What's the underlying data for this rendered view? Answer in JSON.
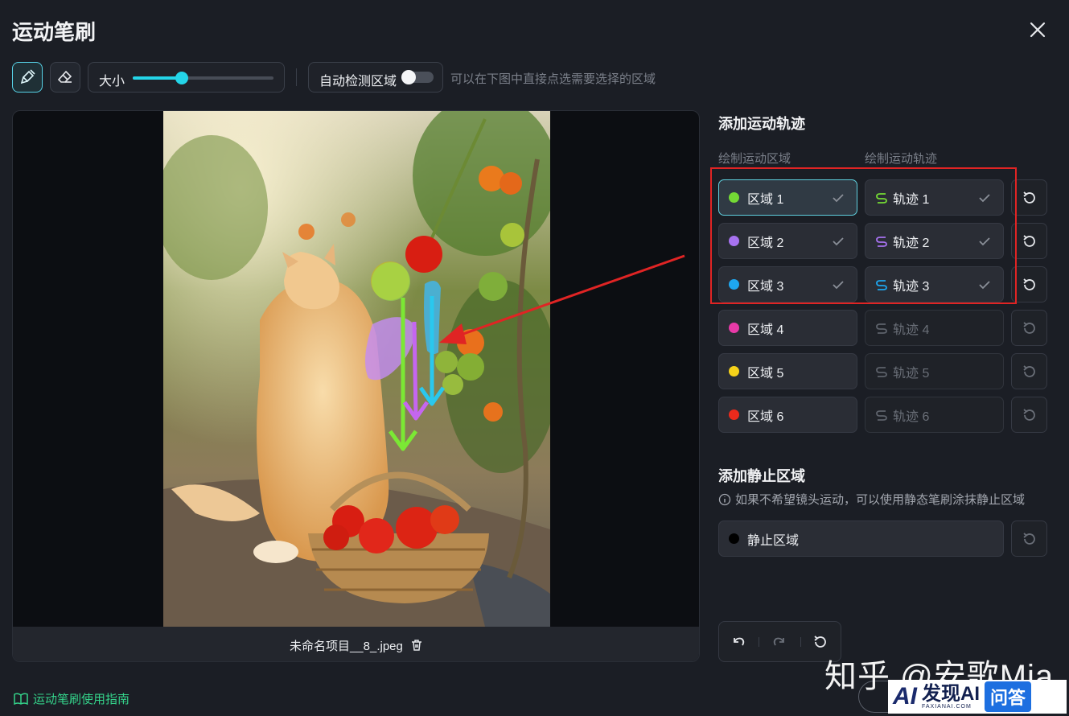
{
  "dialog": {
    "title": "运动笔刷"
  },
  "toolbar": {
    "size_label": "大小",
    "size_value": 0.35,
    "auto_detect_label": "自动检测区域",
    "auto_detect_on": false,
    "hint": "可以在下图中直接点选需要选择的区域"
  },
  "canvas": {
    "file_name": "未命名项目__8_.jpeg"
  },
  "guide_link": "运动笔刷使用指南",
  "motion": {
    "title": "添加运动轨迹",
    "area_col": "绘制运动区域",
    "track_col": "绘制运动轨迹",
    "rows": [
      {
        "area": "区域 1",
        "track": "轨迹 1",
        "color": "#74d935",
        "active": true,
        "selected": true
      },
      {
        "area": "区域 2",
        "track": "轨迹 2",
        "color": "#a772f0",
        "active": true,
        "selected": false
      },
      {
        "area": "区域 3",
        "track": "轨迹 3",
        "color": "#1ea7f0",
        "active": true,
        "selected": false
      },
      {
        "area": "区域 4",
        "track": "轨迹 4",
        "color": "#e83aa8",
        "active": false,
        "selected": false
      },
      {
        "area": "区域 5",
        "track": "轨迹 5",
        "color": "#f5d21a",
        "active": false,
        "selected": false
      },
      {
        "area": "区域 6",
        "track": "轨迹 6",
        "color": "#ec2a1c",
        "active": false,
        "selected": false
      }
    ]
  },
  "static": {
    "title": "添加静止区域",
    "info": "如果不希望镜头运动，可以使用静态笔刷涂抹静止区域",
    "area": "静止区域",
    "color": "#000000"
  },
  "watermark": {
    "text": "知乎 @安歌Mia",
    "logo_main": "发现AI",
    "logo_sub": "FAXIANAI.COM",
    "logo_badge": "问答"
  }
}
